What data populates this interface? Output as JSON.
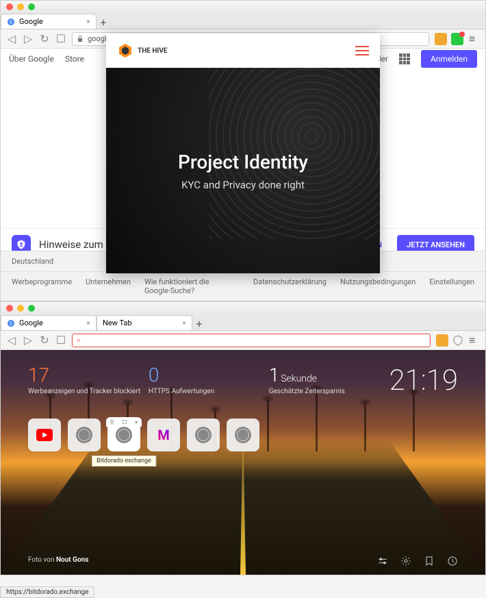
{
  "win1": {
    "tab": {
      "title": "Google"
    },
    "url": "google.de/?gws_rd=ssl",
    "header": {
      "about": "Über Google",
      "store": "Store",
      "images": "Bilder",
      "signin": "Anmelden"
    },
    "popup": {
      "brand": "THE HIVE",
      "title": "Project Identity",
      "subtitle": "KYC and Privacy done right"
    },
    "privacy": {
      "text": "Hinweise zum Dater",
      "later": "NERN",
      "view": "JETZT ANSEHEN"
    },
    "footer": {
      "country": "Deutschland",
      "links": [
        "Werbeprogramme",
        "Unternehmen",
        "Wie funktioniert die Google-Suche?"
      ],
      "right": [
        "Datenschutzerklärung",
        "Nutzungsbedingungen",
        "Einstellungen"
      ]
    }
  },
  "win2": {
    "tabs": [
      {
        "title": "Google"
      },
      {
        "title": "New Tab"
      }
    ],
    "stats": [
      {
        "num": "17",
        "label": "Werbeanzeigen und Tracker blockiert"
      },
      {
        "num": "0",
        "label": "HTTPS Aufwertungen"
      },
      {
        "num": "1",
        "unit": "Sekunde",
        "label": "Geschätzte Zeitersparnis"
      }
    ],
    "clock": "21:19",
    "tile_tooltip": "Bitdorado exchange",
    "credit_prefix": "Foto von ",
    "credit_author": "Nout Gons",
    "status_url": "https://bitdorado.exchange"
  }
}
